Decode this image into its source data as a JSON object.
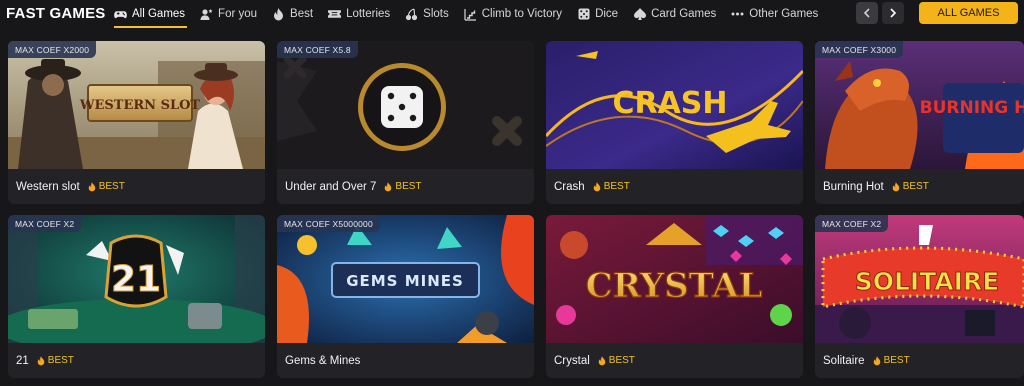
{
  "header": {
    "title": "FAST GAMES",
    "tabs": [
      {
        "label": "All Games",
        "icon": "gamepad-icon",
        "active": true
      },
      {
        "label": "For you",
        "icon": "user-star-icon",
        "active": false
      },
      {
        "label": "Best",
        "icon": "fire-icon",
        "active": false
      },
      {
        "label": "Lotteries",
        "icon": "ticket-icon",
        "active": false
      },
      {
        "label": "Slots",
        "icon": "cherries-icon",
        "active": false
      },
      {
        "label": "Climb to Victory",
        "icon": "stairs-chart-icon",
        "active": false
      },
      {
        "label": "Dice",
        "icon": "dice-icon",
        "active": false
      },
      {
        "label": "Card Games",
        "icon": "spade-icon",
        "active": false
      },
      {
        "label": "Other Games",
        "icon": "more-dots-icon",
        "active": false
      }
    ],
    "all_games_button": "ALL GAMES"
  },
  "games": [
    {
      "name": "Western slot",
      "badge": "MAX COEF X2000",
      "tag": "BEST",
      "art_text": "WESTERN SLOT"
    },
    {
      "name": "Under and Over 7",
      "badge": "MAX COEF X5.8",
      "tag": "BEST",
      "art_text": ""
    },
    {
      "name": "Crash",
      "badge": "",
      "tag": "BEST",
      "art_text": "CRASH"
    },
    {
      "name": "Burning Hot",
      "badge": "MAX COEF X3000",
      "tag": "BEST",
      "art_text": "BURNING HOT"
    },
    {
      "name": "21",
      "badge": "MAX COEF X2",
      "tag": "BEST",
      "art_text": "21"
    },
    {
      "name": "Gems & Mines",
      "badge": "MAX COEF X5000000",
      "tag": "",
      "art_text": "GEMS MINES"
    },
    {
      "name": "Crystal",
      "badge": "",
      "tag": "BEST",
      "art_text": "CRYSTAL"
    },
    {
      "name": "Solitaire",
      "badge": "MAX COEF X2",
      "tag": "BEST",
      "art_text": "SOLITAIRE"
    }
  ],
  "colors": {
    "background": "#17171a",
    "card": "#232327",
    "accent": "#f5b31a",
    "best_text": "#f2c02a",
    "badge": "#283452"
  }
}
